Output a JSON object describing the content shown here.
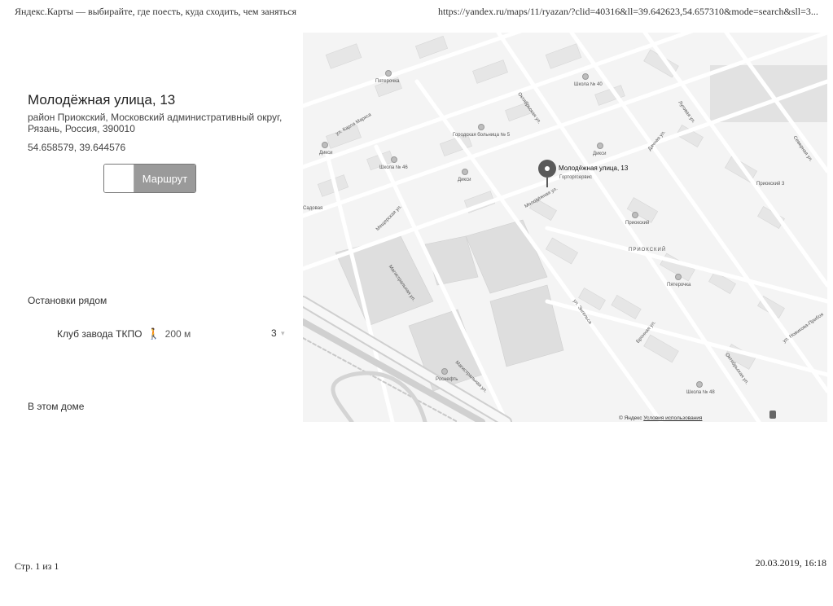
{
  "print_header": {
    "title": "Яндекс.Карты — выбирайте, где поесть, куда сходить, чем заняться",
    "url": "https://yandex.ru/maps/11/ryazan/?clid=40316&ll=39.642623,54.657310&mode=search&sll=3..."
  },
  "place": {
    "name": "Молодёжная улица, 13",
    "address_line1": "район Приокский, Московский административный округ,",
    "address_line2": "Рязань, Россия, 390010",
    "coordinates": "54.658579, 39.644576"
  },
  "route_button": {
    "label": "Маршрут"
  },
  "stops": {
    "title": "Остановки рядом",
    "items": [
      {
        "name": "Клуб завода ТКПО",
        "distance": "200 м",
        "routes_count": "3",
        "walk_icon": "walking-person-icon"
      }
    ]
  },
  "building": {
    "title": "В этом доме"
  },
  "map": {
    "pin_label": "Молодёжная улица, 13",
    "copyright": "© Яндекс",
    "terms": "Условия использования",
    "labels": {
      "oktyabrskaya_1": "Октябрьская ул.",
      "oktyabrskaya_2": "Октябрьская ул.",
      "magistralnaya_1": "Магистральная ул.",
      "magistralnaya_2": "Магистральная ул.",
      "molodezhnaya": "Молодёжная ул.",
      "meshcherskaya": "Мещерская ул.",
      "karla_marksa": "ул. Карла Маркса",
      "priokskiy_district": "ПРИОКСКИЙ",
      "priokskiy_poi": "Приокский",
      "pyaterochka_1": "Пятерочка",
      "pyaterochka_2": "Пятерочка",
      "school_46": "Школа № 46",
      "school_48": "Школа № 48",
      "school_40": "Школа № 40",
      "hospital": "Городская больница № 5",
      "diksi_1": "Дикси",
      "diksi_2": "Дикси",
      "diksi_3": "Дикси",
      "rosneft": "Роснефть",
      "gortorgservis": "Горторгсервис",
      "sadovaya": "Садовая",
      "dachnaya": "Дачная ул.",
      "engelsa": "ул. Энгельса",
      "bronnaya": "Бронная ул.",
      "novikova_priboya": "ул. Новикова-Прибоя",
      "lugovaya": "Луговая ул.",
      "priokskiy_3": "Приокский 3",
      "severnaya": "Северная ул."
    }
  }
}
